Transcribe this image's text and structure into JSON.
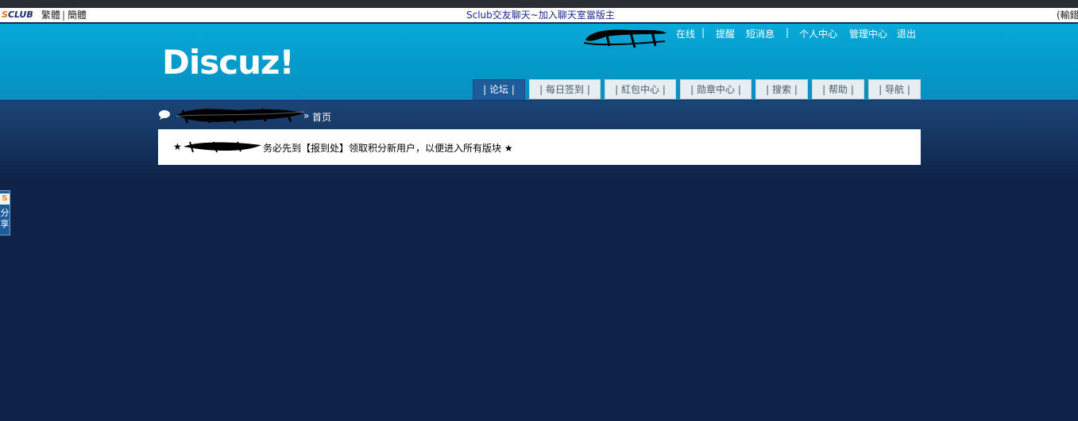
{
  "sclub_bar": {
    "logo": {
      "s": "S",
      "rest": "CLUB"
    },
    "lang_traditional": "繁體",
    "lang_separator": "|",
    "lang_simplified": "簡體",
    "title": "Sclub交友聊天~加入聊天室當版主",
    "right_text": "(輸錯"
  },
  "header": {
    "logo_text": "Discuz!",
    "user_links": {
      "online": "在线",
      "sep1": "|",
      "reminders": "提醒",
      "messages": "短消息",
      "sep2": "|",
      "profile": "个人中心",
      "admin": "管理中心",
      "logout": "退出"
    }
  },
  "nav": {
    "tabs": [
      {
        "label": "| 论坛 |",
        "active": true
      },
      {
        "label": "| 每日签到 |",
        "active": false
      },
      {
        "label": "| 紅包中心 |",
        "active": false
      },
      {
        "label": "| 勋章中心 |",
        "active": false
      },
      {
        "label": "| 搜索 |",
        "active": false
      },
      {
        "label": "| 帮助 |",
        "active": false
      },
      {
        "label": "| 导航 |",
        "active": false
      }
    ]
  },
  "breadcrumb": {
    "separator": "»",
    "home": "首页"
  },
  "notice": {
    "star": "★",
    "text": "务必先到【报到处】领取积分新用户，以便进入所有版块 ★"
  },
  "share": {
    "badge": "S",
    "label": "分享"
  },
  "colors": {
    "header_bg": "#0499c9",
    "page_bg": "#0f2348",
    "active_tab": "#1d5b9b",
    "tab_bg": "#e6eef2"
  }
}
